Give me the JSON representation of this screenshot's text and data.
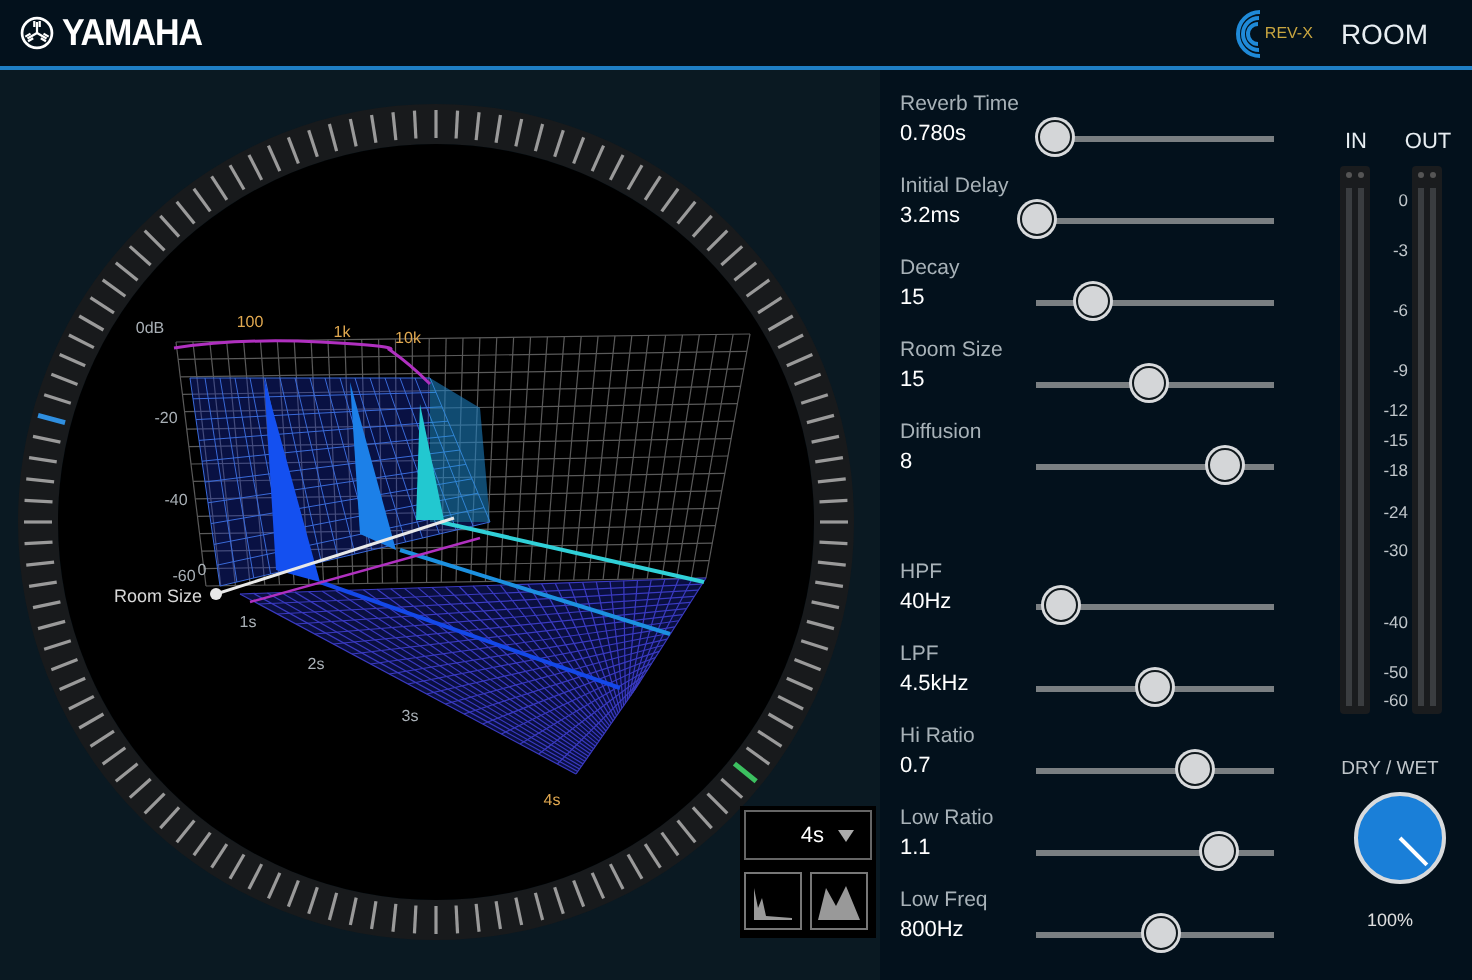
{
  "header": {
    "brand": "YAMAHA",
    "badge": "REV-X",
    "title": "ROOM"
  },
  "display": {
    "amp_labels": [
      "0dB",
      "-20",
      "-40",
      "-60"
    ],
    "freq_labels": [
      "100",
      "1k",
      "10k"
    ],
    "time_labels": [
      "1s",
      "2s",
      "3s",
      "4s"
    ],
    "origin_label": "0",
    "room_size_label": "Room Size",
    "time_range": "4s",
    "view_buttons": [
      {
        "kind": "impulse"
      },
      {
        "kind": "spectrum"
      }
    ]
  },
  "parameter_groups": [
    [
      {
        "label": "Reverb Time",
        "value": "0.780s",
        "level": 0.08
      },
      {
        "label": "Initial Delay",
        "value": "3.2ms",
        "level": 0.01
      },
      {
        "label": "Decay",
        "value": "15",
        "level": 0.24
      },
      {
        "label": "Room Size",
        "value": "15",
        "level": 0.48
      },
      {
        "label": "Diffusion",
        "value": "8",
        "level": 0.8
      }
    ],
    [
      {
        "label": "HPF",
        "value": "40Hz",
        "level": 0.11
      },
      {
        "label": "LPF",
        "value": "4.5kHz",
        "level": 0.5
      },
      {
        "label": "Hi Ratio",
        "value": "0.7",
        "level": 0.67
      },
      {
        "label": "Low Ratio",
        "value": "1.1",
        "level": 0.77
      },
      {
        "label": "Low Freq",
        "value": "800Hz",
        "level": 0.53
      }
    ]
  ],
  "meters": {
    "channels": [
      {
        "label": "IN"
      },
      {
        "label": "OUT"
      }
    ],
    "scale": [
      "0",
      "-3",
      "-6",
      "-9",
      "-12",
      "-15",
      "-18",
      "-24",
      "-30",
      "-40",
      "-50",
      "-60"
    ]
  },
  "mix": {
    "label": "DRY / WET",
    "level": 1,
    "reading": "100%"
  }
}
